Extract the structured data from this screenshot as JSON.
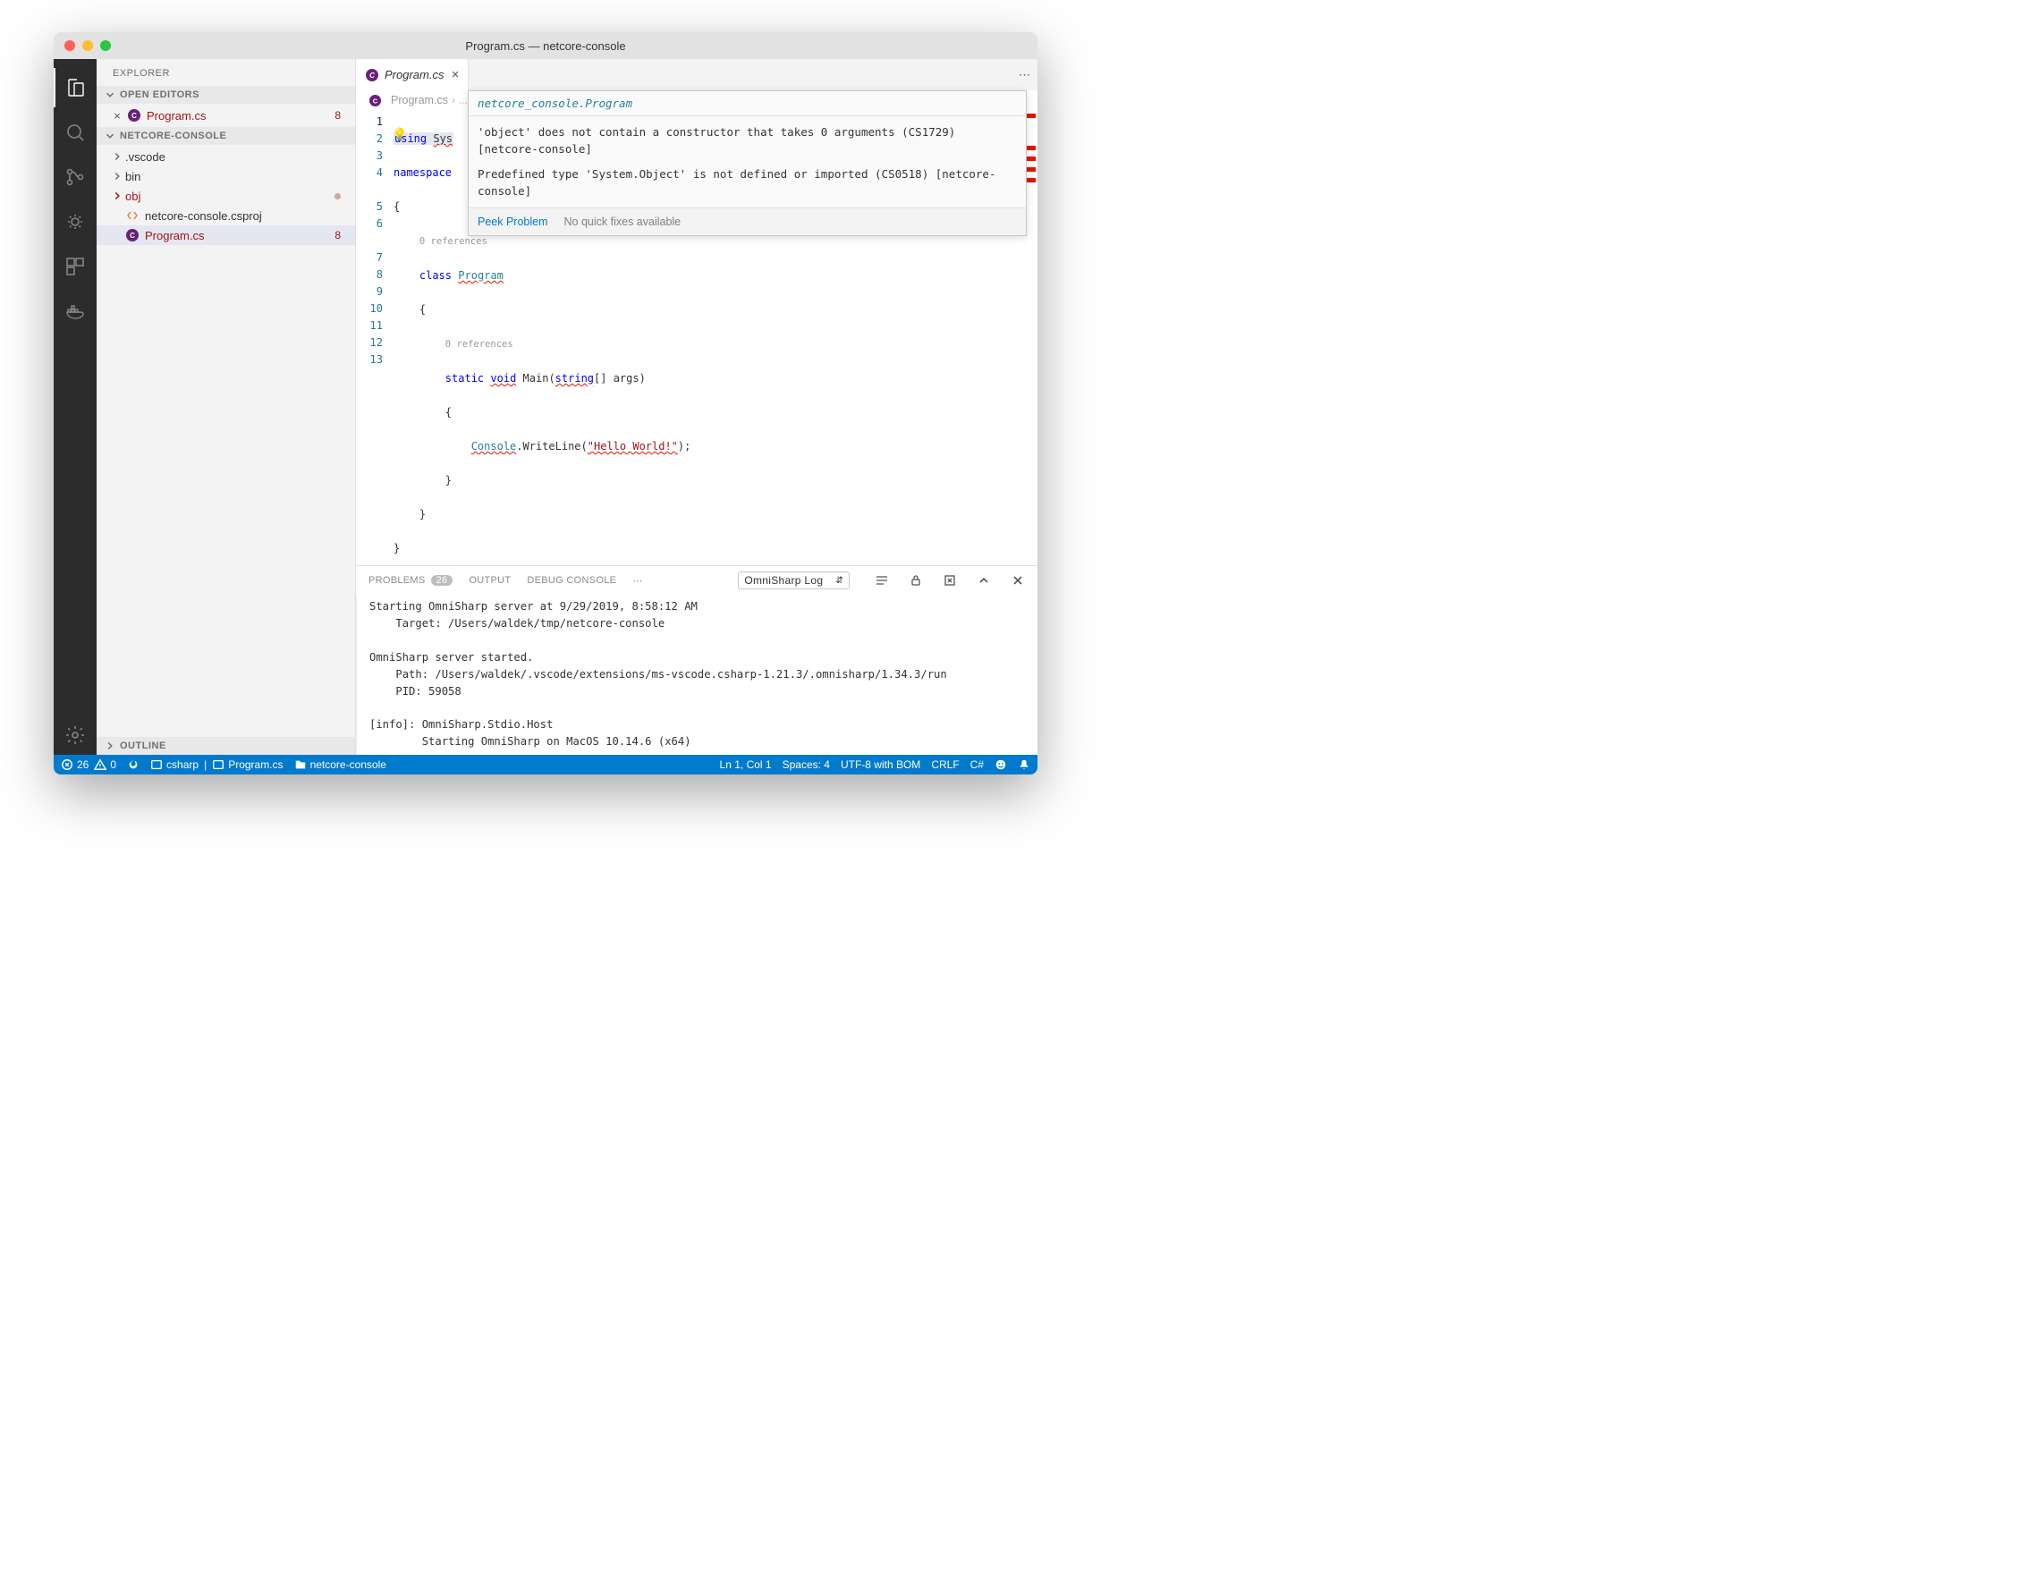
{
  "window": {
    "title": "Program.cs — netcore-console"
  },
  "sidebar": {
    "title": "EXPLORER",
    "open_editors_label": "OPEN EDITORS",
    "workspace_label": "NETCORE-CONSOLE",
    "outline_label": "OUTLINE",
    "open_editors": [
      {
        "name": "Program.cs",
        "errors": "8"
      }
    ],
    "tree": [
      {
        "name": ".vscode",
        "folder": true
      },
      {
        "name": "bin",
        "folder": true
      },
      {
        "name": "obj",
        "folder": true,
        "dirty": true,
        "err": true
      },
      {
        "name": "netcore-console.csproj",
        "icon": "xml-icon"
      },
      {
        "name": "Program.cs",
        "icon": "csharp-icon",
        "err": true,
        "errors": "8",
        "selected": true
      }
    ]
  },
  "tab": {
    "name": "Program.cs"
  },
  "breadcrumb": {
    "file": "Program.cs",
    "extra": "› ..."
  },
  "hover": {
    "title": "netcore_console.Program",
    "msg1": "'object' does not contain a constructor that takes 0 arguments (CS1729) [netcore-console]",
    "msg2": "Predefined type 'System.Object' is not defined or imported (CS0518) [netcore-console]",
    "peek": "Peek Problem",
    "noquick": "No quick fixes available"
  },
  "code": {
    "lines": [
      "1",
      "2",
      "3",
      "4",
      "5",
      "6",
      "7",
      "8",
      "9",
      "10",
      "11",
      "12",
      "13"
    ],
    "ref0": "0 references",
    "ref1": "0 references",
    "t_using": "using",
    "t_sys": "Sys",
    "t_namespace": "namespace",
    "t_class": "class",
    "t_program": "Program",
    "t_static": "static",
    "t_void": "void",
    "t_main": "Main",
    "t_string": "string",
    "t_args": "[] args)",
    "t_console": "Console",
    "t_writeline": ".WriteLine(",
    "t_hello": "\"Hello World!\"",
    "t_end": ");"
  },
  "panel": {
    "problems": "PROBLEMS",
    "problems_count": "26",
    "output": "OUTPUT",
    "debug": "DEBUG CONSOLE",
    "dropdown": "OmniSharp Log",
    "log": "Starting OmniSharp server at 9/29/2019, 8:58:12 AM\n    Target: /Users/waldek/tmp/netcore-console\n\nOmniSharp server started.\n    Path: /Users/waldek/.vscode/extensions/ms-vscode.csharp-1.21.3/.omnisharp/1.34.3/run\n    PID: 59058\n\n[info]: OmniSharp.Stdio.Host\n        Starting OmniSharp on MacOS 10.14.6 (x64)"
  },
  "status": {
    "err": "26",
    "warn": "0",
    "csharp": "csharp",
    "file": "Program.cs",
    "proj": "netcore-console",
    "pos": "Ln 1, Col 1",
    "spaces": "Spaces: 4",
    "enc": "UTF-8 with BOM",
    "eol": "CRLF",
    "lang": "C#"
  }
}
